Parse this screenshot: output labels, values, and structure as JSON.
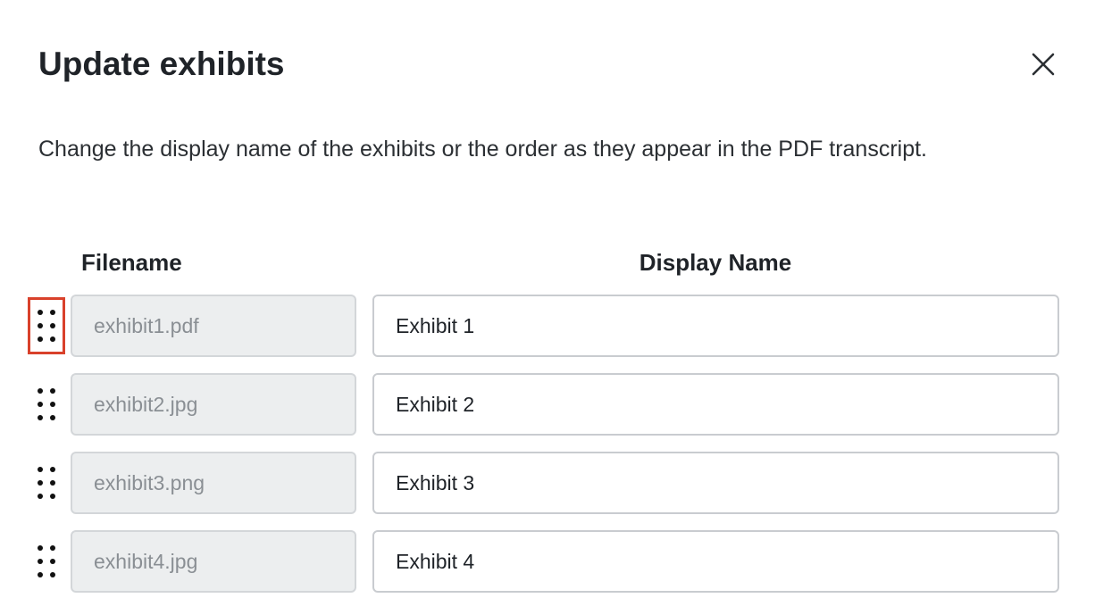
{
  "dialog": {
    "title": "Update exhibits",
    "description": "Change the display name of the exhibits or the order as they appear in the PDF transcript.",
    "close_icon": "close-icon"
  },
  "table": {
    "headers": {
      "filename": "Filename",
      "display_name": "Display Name"
    },
    "rows": [
      {
        "filename": "exhibit1.pdf",
        "display_name": "Exhibit 1",
        "focused": true
      },
      {
        "filename": "exhibit2.jpg",
        "display_name": "Exhibit 2",
        "focused": false
      },
      {
        "filename": "exhibit3.png",
        "display_name": "Exhibit 3",
        "focused": false
      },
      {
        "filename": "exhibit4.jpg",
        "display_name": "Exhibit 4",
        "focused": false
      }
    ],
    "drag_icon": "drag-handle-icon"
  },
  "colors": {
    "focus_ring": "#d9412b",
    "readonly_bg": "#eceeef",
    "text": "#1f2328"
  }
}
